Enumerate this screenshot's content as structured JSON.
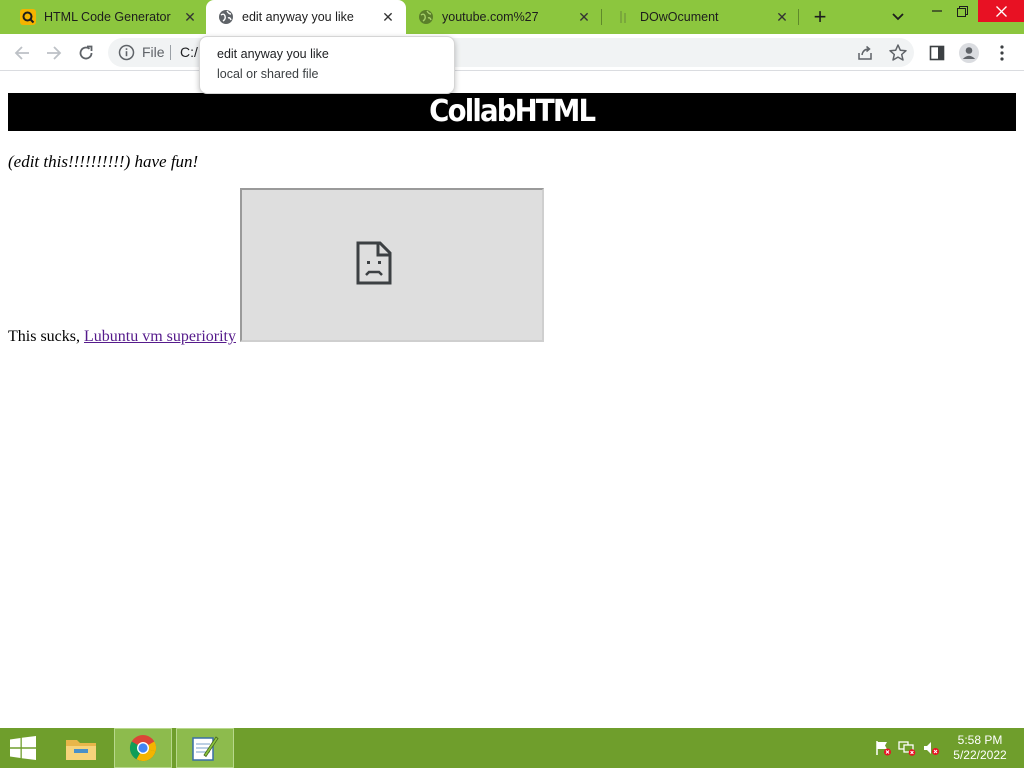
{
  "colors": {
    "tabstrip_bg": "#8cc63e",
    "taskbar_bg": "#6f9e2c",
    "banner_bg": "#000000",
    "visited_link": "#551a8b",
    "close_button": "#e81123"
  },
  "tabs": [
    {
      "label": "HTML Code Generator",
      "icon": "html-generator-favicon"
    },
    {
      "label": "edit anyway you like",
      "icon": "globe-icon",
      "active": true
    },
    {
      "label": "youtube.com%27",
      "icon": "globe-icon"
    },
    {
      "label": "DOwOcument",
      "icon": "document-favicon"
    }
  ],
  "tooltip": {
    "title": "edit anyway you like",
    "subtitle": "local or shared file"
  },
  "toolbar": {
    "scheme_label": "File",
    "url": "C:/"
  },
  "page": {
    "banner": "CollabHTML",
    "italic_text": "(edit this!!!!!!!!!!) have fun!",
    "body_prefix": "This sucks, ",
    "link_text": "Lubuntu vm superiority"
  },
  "taskbar": {
    "apps": [
      "file-explorer-icon",
      "chrome-icon",
      "notepad-icon"
    ],
    "time": "5:58 PM",
    "date": "5/22/2022"
  }
}
